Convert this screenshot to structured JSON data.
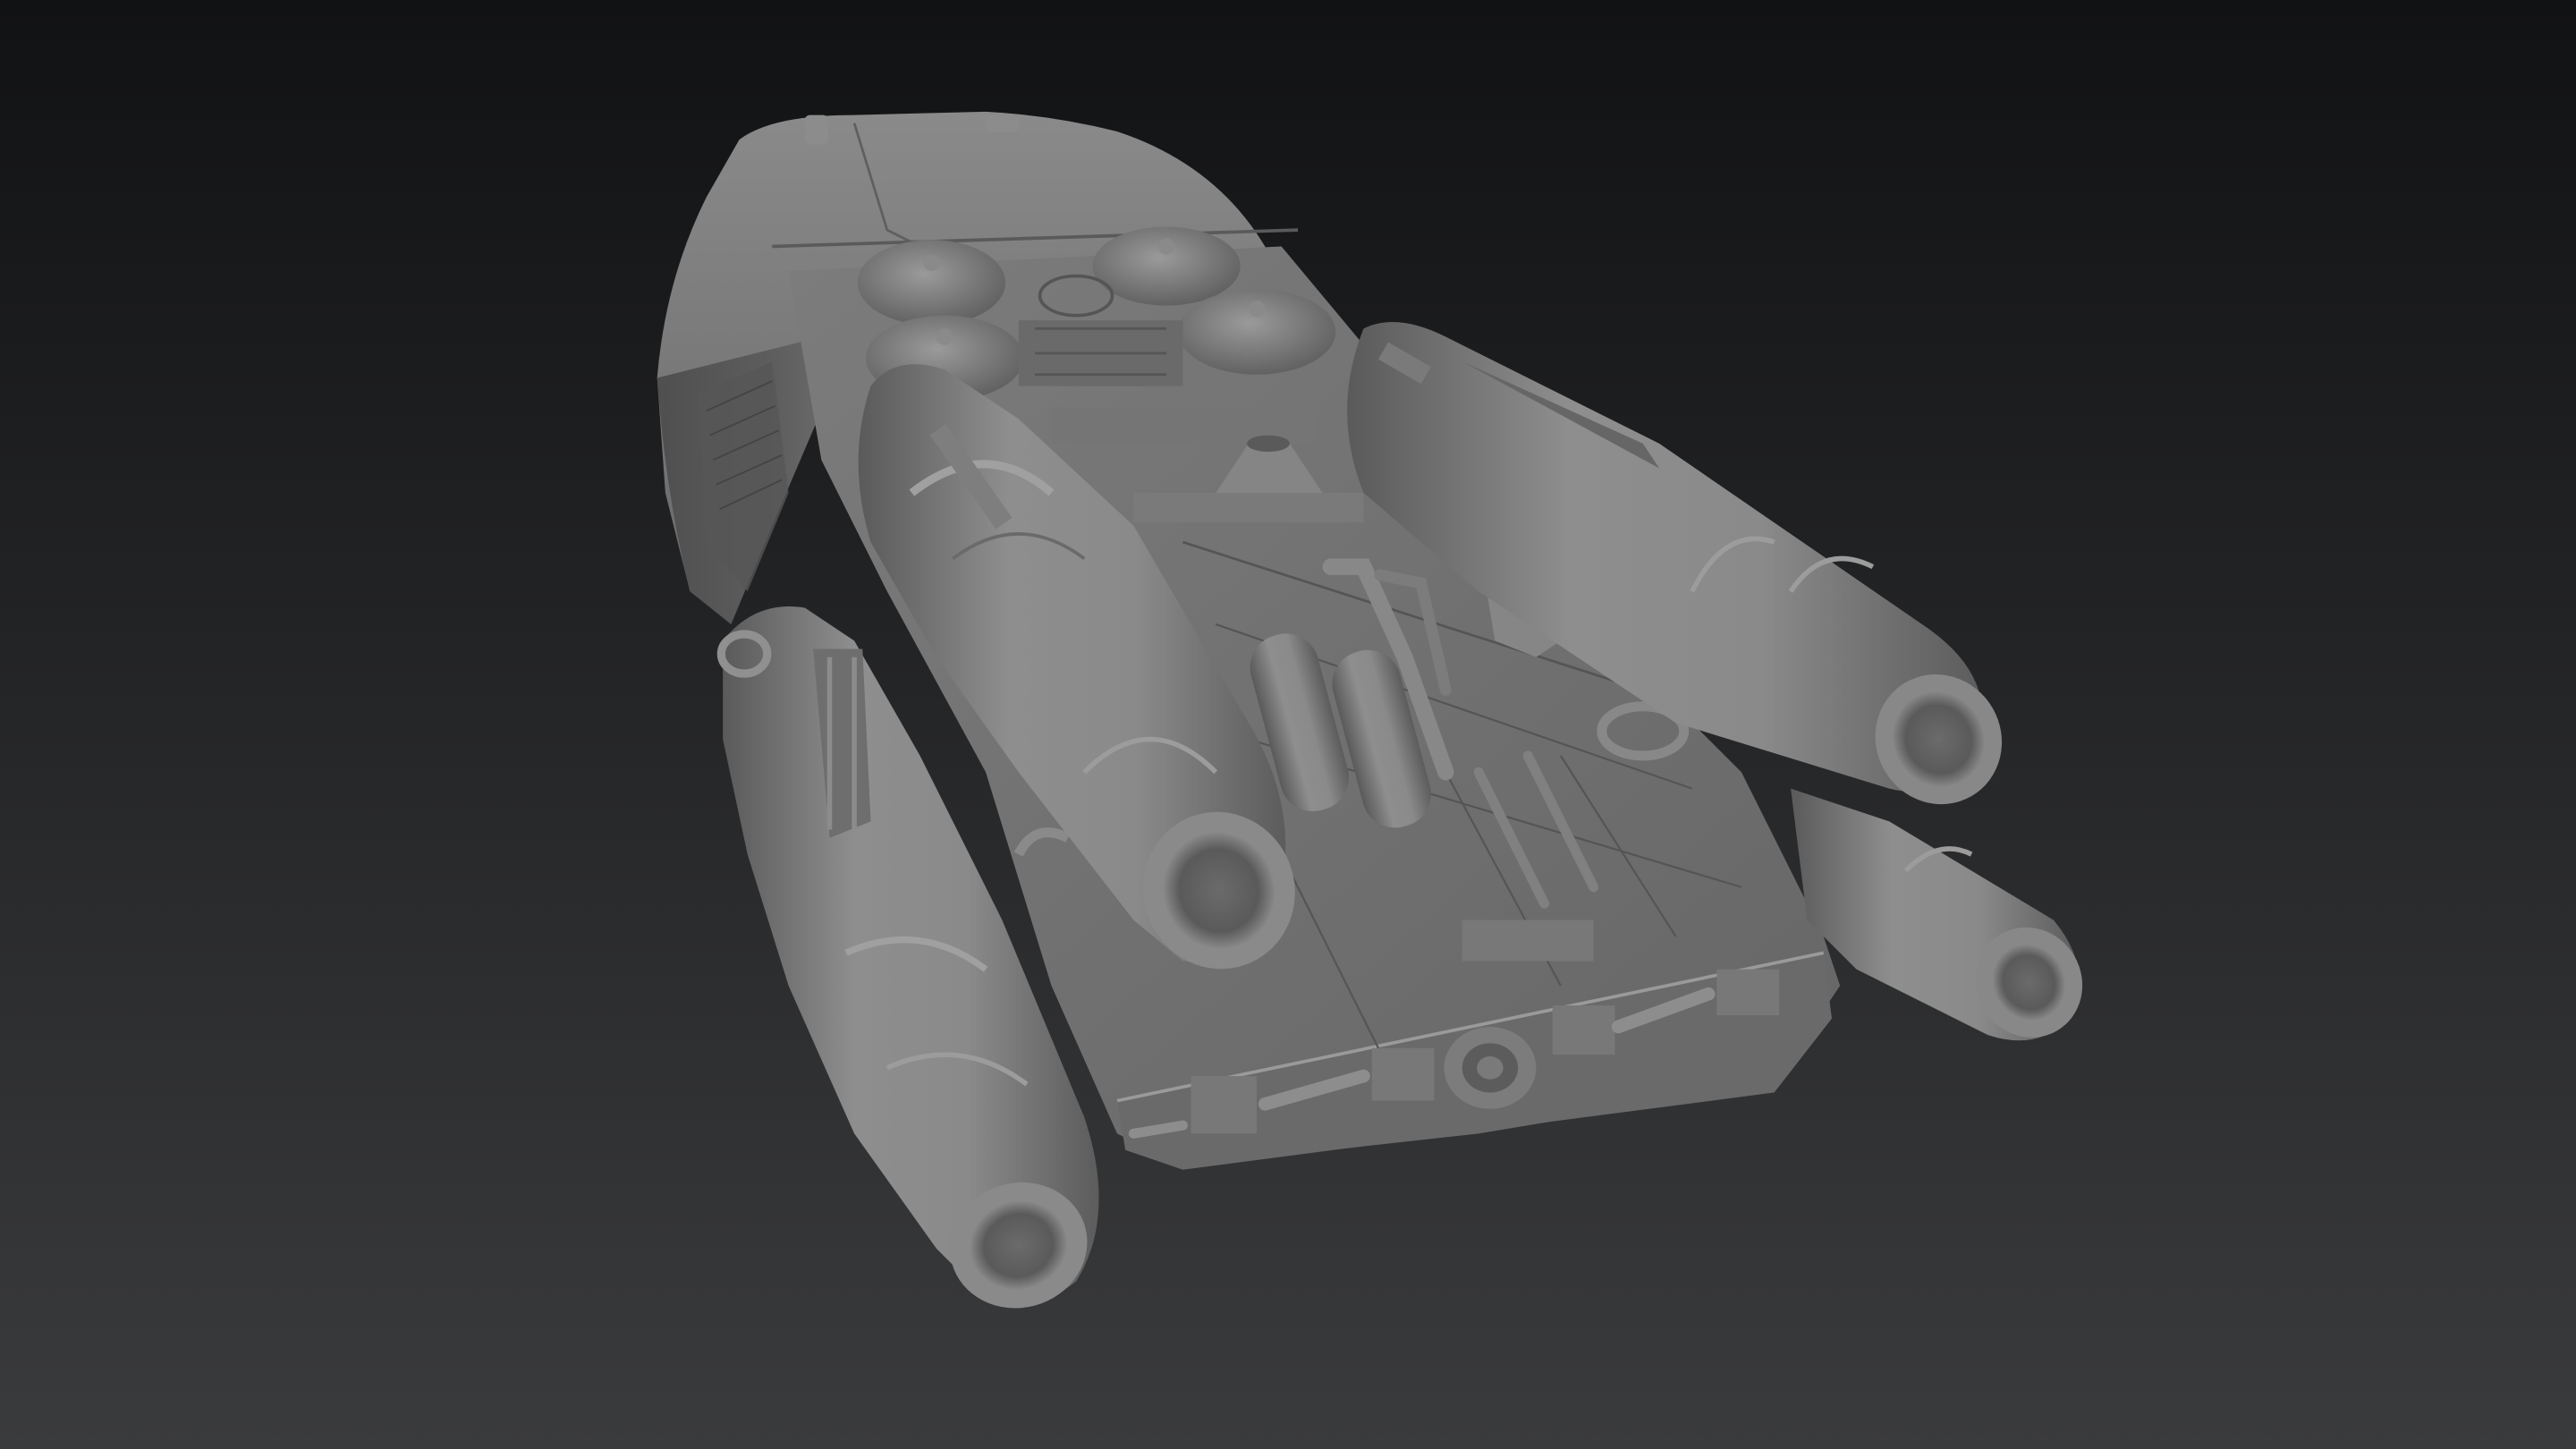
{
  "viewport": {
    "background_top": "#111214",
    "background_bottom": "#3a3b3d",
    "model_color": "#7a7a7a"
  },
  "model": {
    "object": "spaceship",
    "render_style": "grey-shaded-3d-model",
    "engine_count": 4
  }
}
